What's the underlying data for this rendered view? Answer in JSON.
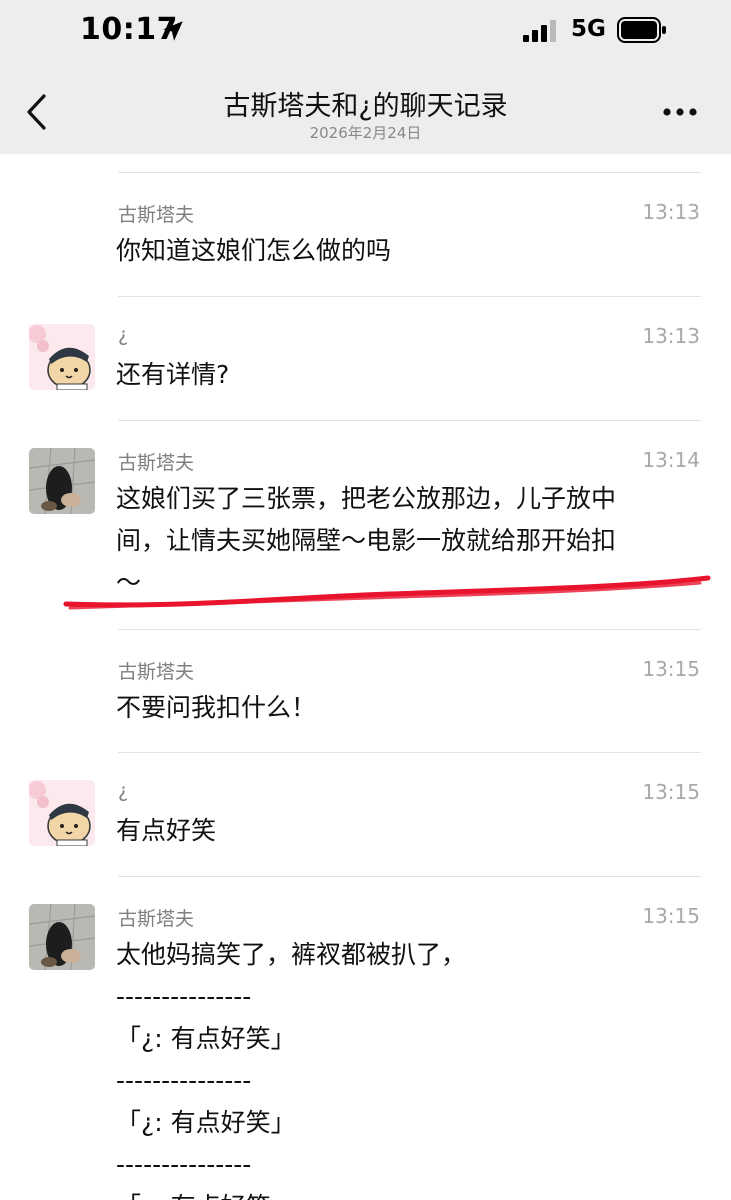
{
  "status_bar": {
    "time": "10:17",
    "network": "5G"
  },
  "header": {
    "title": "古斯塔夫和¿的聊天记录",
    "subtitle": "2026年2月24日"
  },
  "colors": {
    "background": "#ededed",
    "annotation": "#e8142d"
  },
  "messages": [
    {
      "sender": "古斯塔夫",
      "time": "13:13",
      "text": "你知道这娘们怎么做的吗",
      "avatar": "none"
    },
    {
      "sender": "¿",
      "time": "13:13",
      "text": "还有详情?",
      "avatar": "cartoon-dog-avatar"
    },
    {
      "sender": "古斯塔夫",
      "time": "13:14",
      "text": "这娘们买了三张票，把老公放那边，儿子放中\n间，让情夫买她隔壁～电影一放就给那开始扣\n～",
      "avatar": "photo-avatar"
    },
    {
      "sender": "古斯塔夫",
      "time": "13:15",
      "text": "不要问我扣什么！",
      "avatar": "none"
    },
    {
      "sender": "¿",
      "time": "13:15",
      "text": "有点好笑",
      "avatar": "cartoon-dog-avatar"
    },
    {
      "sender": "古斯塔夫",
      "time": "13:15",
      "text": "太他妈搞笑了，裤衩都被扒了，\n---------------\n「¿: 有点好笑」\n---------------\n「¿: 有点好笑」\n---------------\n「¿: 有点好笑」",
      "avatar": "photo-avatar"
    }
  ]
}
